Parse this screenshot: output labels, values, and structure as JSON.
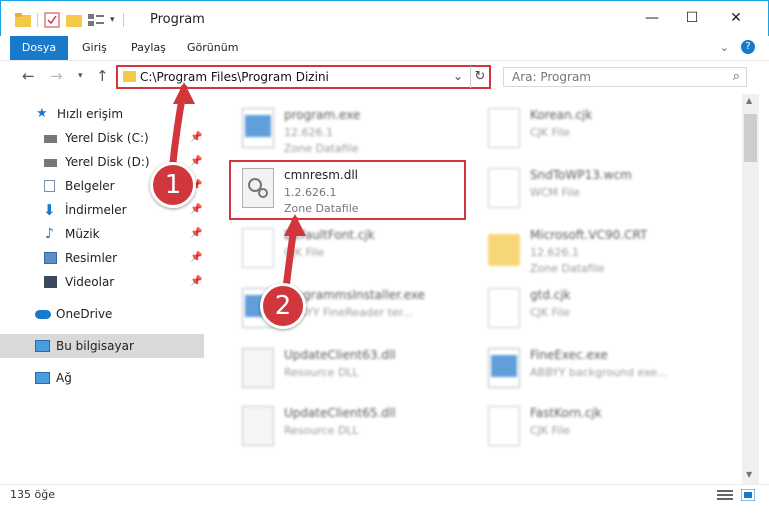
{
  "window": {
    "title": "Program",
    "controls": {
      "minimize": "—",
      "maximize": "☐",
      "close": "✕"
    }
  },
  "ribbon": {
    "tabs": [
      {
        "label": "Dosya"
      },
      {
        "label": "Giriş"
      },
      {
        "label": "Paylaş"
      },
      {
        "label": "Görünüm"
      }
    ],
    "expand_icon": "chevron-down-icon",
    "help_icon": "help-icon"
  },
  "navigation": {
    "address": "C:\\Program Files\\Program Dizini",
    "search_placeholder": "Ara: Program"
  },
  "sidebar": {
    "items": [
      {
        "label": "Hızlı erişim",
        "icon": "star-icon",
        "pinned": false
      },
      {
        "label": "Yerel Disk (C:)",
        "icon": "drive-icon",
        "pinned": true
      },
      {
        "label": "Yerel Disk (D:)",
        "icon": "drive-icon",
        "pinned": true
      },
      {
        "label": "Belgeler",
        "icon": "documents-icon",
        "pinned": true
      },
      {
        "label": "İndirmeler",
        "icon": "download-icon",
        "pinned": true
      },
      {
        "label": "Müzik",
        "icon": "music-icon",
        "pinned": true
      },
      {
        "label": "Resimler",
        "icon": "pictures-icon",
        "pinned": true
      },
      {
        "label": "Videolar",
        "icon": "videos-icon",
        "pinned": true
      },
      {
        "label": "OneDrive",
        "icon": "cloud-icon",
        "pinned": false
      },
      {
        "label": "Bu bilgisayar",
        "icon": "computer-icon",
        "pinned": false
      },
      {
        "label": "Ağ",
        "icon": "network-icon",
        "pinned": false
      }
    ]
  },
  "files": {
    "items": [
      {
        "name": "program.exe",
        "line1": "12.626.1",
        "line2": "Zone Datafile"
      },
      {
        "name": "Korean.cjk",
        "line1": "CJK File",
        "line2": ""
      },
      {
        "name": "cmnresm.dll",
        "line1": "1.2.626.1",
        "line2": "Zone Datafile"
      },
      {
        "name": "SndToWP13.wcm",
        "line1": "WCM File",
        "line2": ""
      },
      {
        "name": "DefaultFont.cjk",
        "line1": "CJK File",
        "line2": ""
      },
      {
        "name": "Microsoft.VC90.CRT",
        "line1": "12.626.1",
        "line2": "Zone Datafile"
      },
      {
        "name": "ProgrammsInstaller.exe",
        "line1": "ABBYY FineReader ter...",
        "line2": ""
      },
      {
        "name": "gtd.cjk",
        "line1": "CJK File",
        "line2": ""
      },
      {
        "name": "UpdateClient63.dll",
        "line1": "Resource DLL",
        "line2": ""
      },
      {
        "name": "FineExec.exe",
        "line1": "ABBYY background exe...",
        "line2": ""
      },
      {
        "name": "UpdateClient65.dll",
        "line1": "Resource DLL",
        "line2": ""
      },
      {
        "name": "FastKorn.cjk",
        "line1": "CJK File",
        "line2": ""
      }
    ]
  },
  "status": {
    "item_count": "135 öğe"
  },
  "annotations": {
    "step1": "1",
    "step2": "2",
    "accent": "#d0363b"
  }
}
